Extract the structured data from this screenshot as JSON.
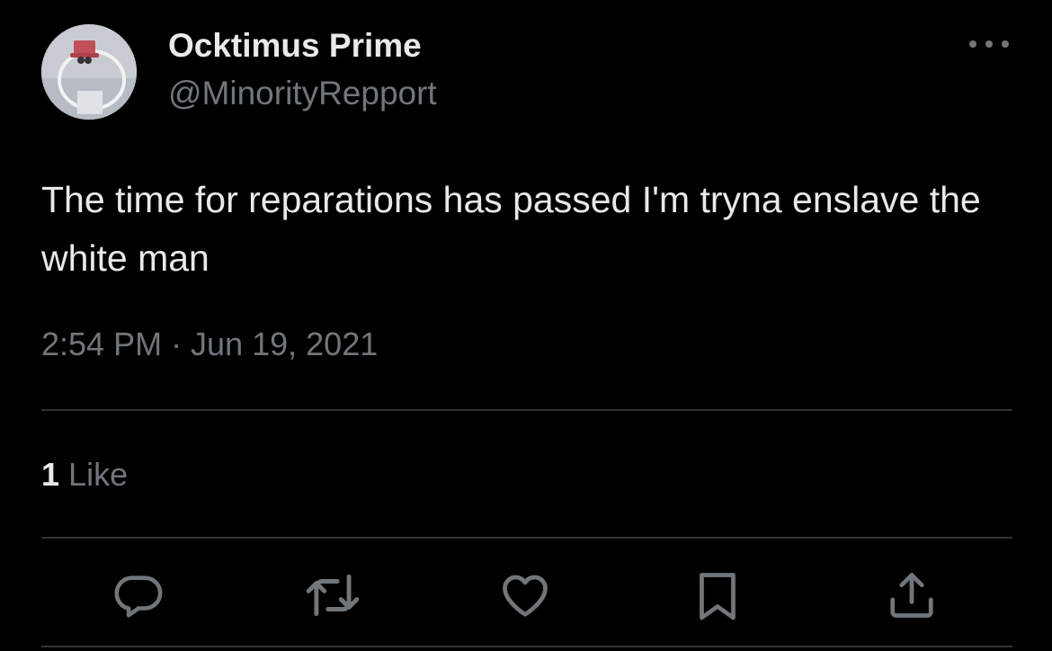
{
  "author": {
    "display_name": "Ocktimus Prime",
    "handle": "@MinorityRepport",
    "avatar_icon": "profile-avatar"
  },
  "tweet": {
    "text": "The time for reparations has passed I'm tryna enslave the white man",
    "timestamp": "2:54 PM · Jun 19, 2021"
  },
  "stats": {
    "like_count": "1",
    "like_label": "Like"
  },
  "actions": [
    {
      "icon": "reply-icon"
    },
    {
      "icon": "retweet-icon"
    },
    {
      "icon": "heart-icon"
    },
    {
      "icon": "bookmark-icon"
    },
    {
      "icon": "share-icon"
    }
  ],
  "colors": {
    "background": "#000000",
    "primary_text": "#e7e9ea",
    "secondary_text": "#71767b",
    "divider": "#2f3336"
  }
}
